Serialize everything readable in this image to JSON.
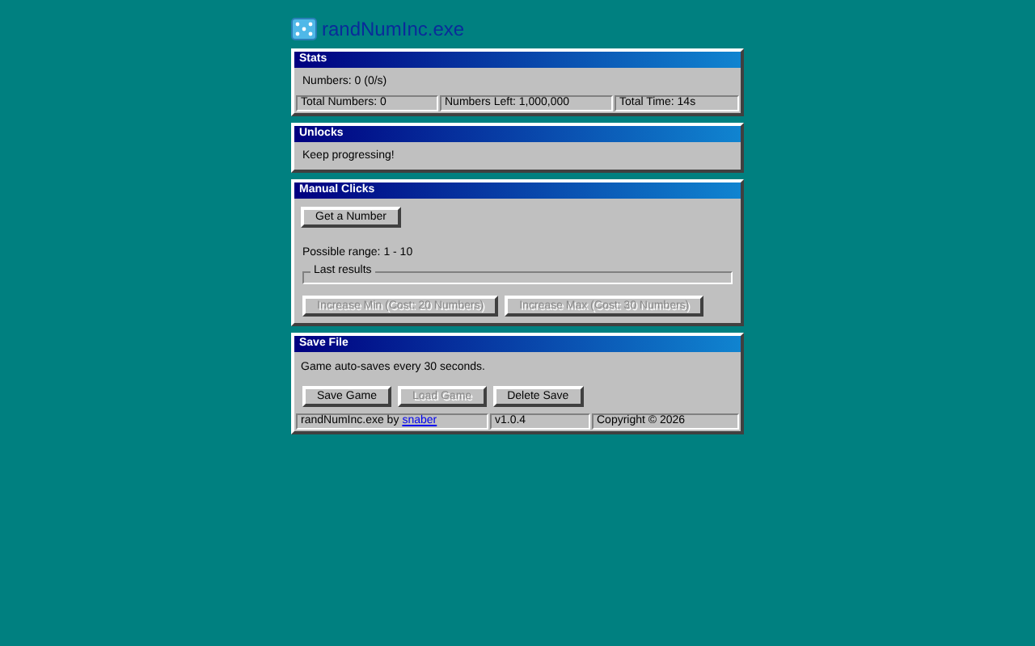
{
  "app": {
    "title": "randNumInc.exe"
  },
  "stats": {
    "title": "Stats",
    "numbers": "Numbers: 0 (0/s)",
    "cells": [
      "Total Numbers: 0",
      "Numbers Left: 1,000,000",
      "Total Time: 14s"
    ]
  },
  "unlocks": {
    "title": "Unlocks",
    "message": "Keep progressing!"
  },
  "manual": {
    "title": "Manual Clicks",
    "get_button": {
      "label": "Get a Number",
      "disabled": false
    },
    "range": "Possible range: 1 - 10",
    "last_results": {
      "legend": "Last results"
    },
    "upgrades": [
      {
        "label": "Increase Min (Cost: 20 Numbers)",
        "disabled": true
      },
      {
        "label": "Increase Max (Cost: 30 Numbers)",
        "disabled": true
      }
    ]
  },
  "save": {
    "title": "Save File",
    "note": "Game auto-saves every 30 seconds.",
    "buttons": [
      {
        "label": "Save Game",
        "disabled": false
      },
      {
        "label": "Load Game",
        "disabled": true
      },
      {
        "label": "Delete Save",
        "disabled": false
      }
    ]
  },
  "footer": {
    "credit": "randNumInc.exe by",
    "author_link": "snaber",
    "version": "v1.0.4",
    "copyright": "Copyright © 2026"
  }
}
